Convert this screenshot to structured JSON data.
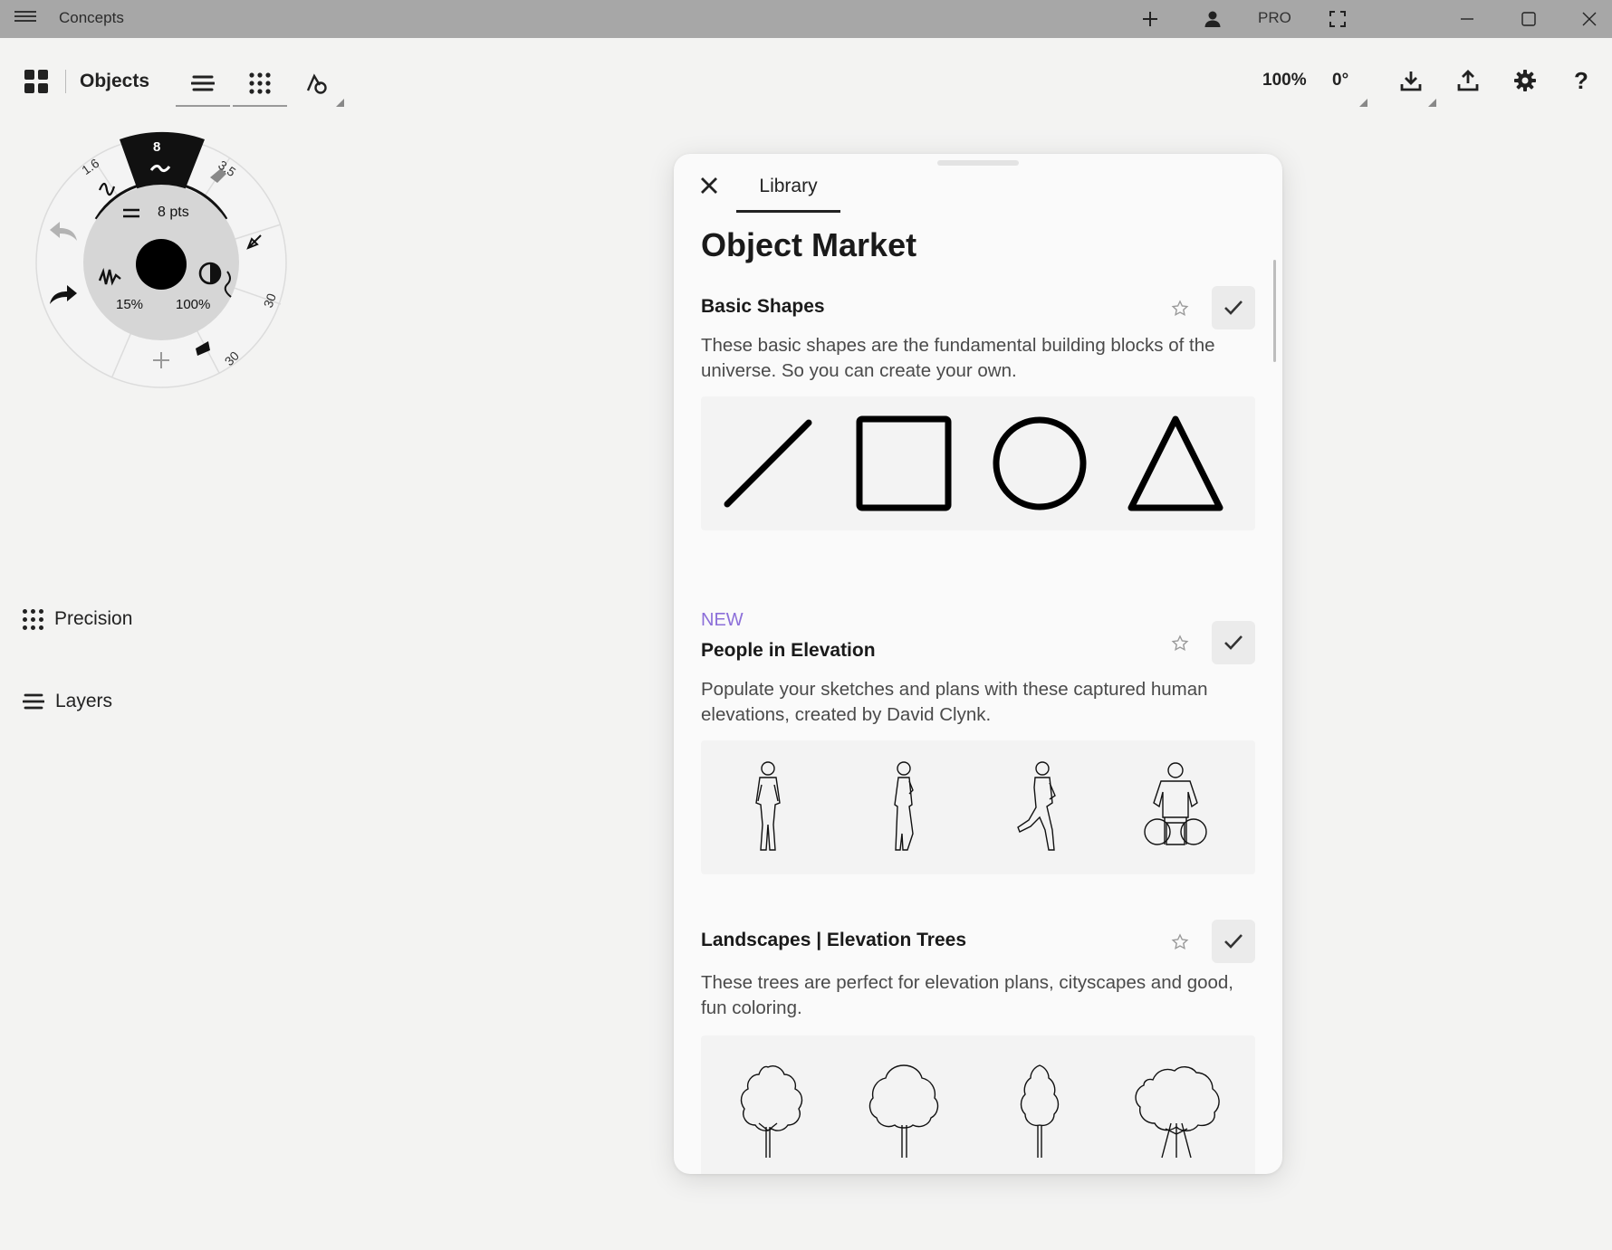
{
  "titlebar": {
    "app_title": "Concepts",
    "pro_label": "PRO",
    "icons": [
      "hamburger-icon",
      "plus-icon",
      "account-icon",
      "fullscreen-icon",
      "minimize-icon",
      "maximize-icon",
      "close-icon"
    ]
  },
  "toolbar": {
    "section_label": "Objects",
    "zoom": "100%",
    "rotation": "0°",
    "icons": [
      "gallery-grid-icon",
      "layers-icon",
      "precision-grid-icon",
      "shapes-icon",
      "import-icon",
      "export-icon",
      "gear-icon",
      "help-icon"
    ]
  },
  "brush_wheel": {
    "active_size": "8",
    "left_size": "1.6",
    "right_size": "3.5",
    "size_readout": "8 pts",
    "smoothing": "15%",
    "opacity": "100%",
    "tool_sizes": [
      "30",
      "30"
    ],
    "active_color": "#000000"
  },
  "side_panel": {
    "precision_label": "Precision",
    "layers_label": "Layers"
  },
  "library": {
    "tab_label": "Library",
    "title": "Object Market",
    "packs": [
      {
        "badge": "",
        "title": "Basic Shapes",
        "description": "These basic shapes are the fundamental building blocks of the universe. So you can create your own.",
        "thumbnails": [
          "line-shape",
          "square-shape",
          "circle-shape",
          "triangle-shape"
        ]
      },
      {
        "badge": "NEW",
        "title": "People in Elevation",
        "description": "Populate your sketches and plans with these captured human elevations, created by David Clynk.",
        "thumbnails": [
          "person-walking",
          "person-standing",
          "person-running",
          "person-wheelchair"
        ]
      },
      {
        "badge": "",
        "title": "Landscapes | Elevation Trees",
        "description": "These trees are perfect for elevation plans, cityscapes and good, fun coloring.",
        "thumbnails": [
          "tree-round",
          "tree-broad",
          "tree-narrow",
          "tree-spreading"
        ]
      }
    ],
    "accent_new_color": "#8c6fd9"
  }
}
